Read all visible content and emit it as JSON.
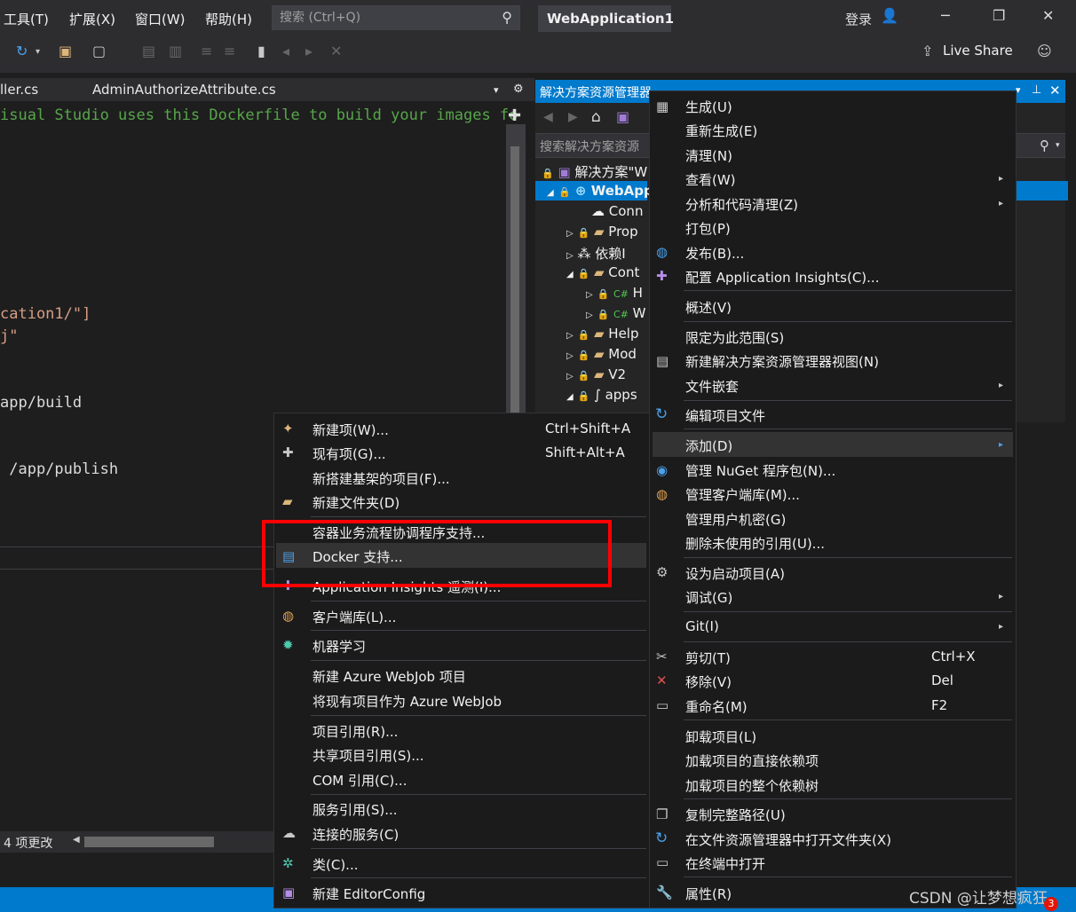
{
  "menubar": {
    "items": [
      "工具(T)",
      "扩展(X)",
      "窗口(W)",
      "帮助(H)"
    ],
    "search_placeholder": "搜索 (Ctrl+Q)",
    "app_name": "WebApplication1",
    "login": "登录"
  },
  "toolbar": {
    "live_share": "Live Share"
  },
  "editor": {
    "tabs": [
      "ller.cs",
      "AdminAuthorizeAttribute.cs"
    ],
    "lines": [
      "isual Studio uses this Dockerfile to build your images fo",
      "cation1/\"]",
      "j\"",
      "app/build",
      " /app/publish"
    ],
    "changes": "4 项更改"
  },
  "solution_explorer": {
    "title": "解决方案资源管理器",
    "search_placeholder": "搜索解决方案资源",
    "tree": [
      "解决方案\"W",
      "WebApp",
      "Conn",
      "Prop",
      "依赖I",
      "Cont",
      "H",
      "W",
      "Help",
      "Mod",
      "V2",
      "apps"
    ]
  },
  "left_menu": {
    "items": [
      {
        "label": "新建项(W)...",
        "shortcut": "Ctrl+Shift+A"
      },
      {
        "label": "现有项(G)...",
        "shortcut": "Shift+Alt+A"
      },
      {
        "label": "新搭建基架的项目(F)..."
      },
      {
        "label": "新建文件夹(D)"
      },
      {
        "label": "容器业务流程协调程序支持..."
      },
      {
        "label": "Docker 支持..."
      },
      {
        "label": "Application Insights 遥测(I)..."
      },
      {
        "label": "客户端库(L)..."
      },
      {
        "label": "机器学习"
      },
      {
        "label": "新建 Azure WebJob 项目"
      },
      {
        "label": "将现有项目作为 Azure WebJob"
      },
      {
        "label": "项目引用(R)..."
      },
      {
        "label": "共享项目引用(S)..."
      },
      {
        "label": "COM 引用(C)..."
      },
      {
        "label": "服务引用(S)..."
      },
      {
        "label": "连接的服务(C)"
      },
      {
        "label": "类(C)..."
      },
      {
        "label": "新建 EditorConfig"
      }
    ]
  },
  "right_menu": {
    "items": [
      {
        "label": "生成(U)"
      },
      {
        "label": "重新生成(E)"
      },
      {
        "label": "清理(N)"
      },
      {
        "label": "查看(W)"
      },
      {
        "label": "分析和代码清理(Z)"
      },
      {
        "label": "打包(P)"
      },
      {
        "label": "发布(B)..."
      },
      {
        "label": "配置 Application Insights(C)..."
      },
      {
        "label": "概述(V)"
      },
      {
        "label": "限定为此范围(S)"
      },
      {
        "label": "新建解决方案资源管理器视图(N)"
      },
      {
        "label": "文件嵌套"
      },
      {
        "label": "编辑项目文件"
      },
      {
        "label": "添加(D)"
      },
      {
        "label": "管理 NuGet 程序包(N)..."
      },
      {
        "label": "管理客户端库(M)..."
      },
      {
        "label": "管理用户机密(G)"
      },
      {
        "label": "删除未使用的引用(U)..."
      },
      {
        "label": "设为启动项目(A)"
      },
      {
        "label": "调试(G)"
      },
      {
        "label": "Git(I)"
      },
      {
        "label": "剪切(T)",
        "shortcut": "Ctrl+X"
      },
      {
        "label": "移除(V)",
        "shortcut": "Del"
      },
      {
        "label": "重命名(M)",
        "shortcut": "F2"
      },
      {
        "label": "卸载项目(L)"
      },
      {
        "label": "加载项目的直接依赖项"
      },
      {
        "label": "加载项目的整个依赖树"
      },
      {
        "label": "复制完整路径(U)"
      },
      {
        "label": "在文件资源管理器中打开文件夹(X)"
      },
      {
        "label": "在终端中打开"
      },
      {
        "label": "属性(R)"
      }
    ]
  },
  "watermark": "CSDN @让梦想疯狂",
  "badge": "3"
}
